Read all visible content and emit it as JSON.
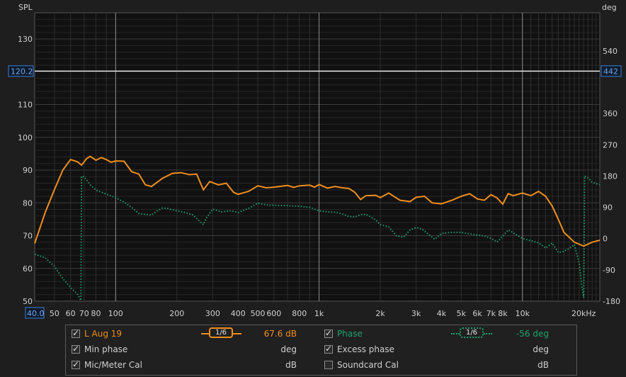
{
  "chart_data": {
    "type": "line",
    "left_axis_label": "SPL",
    "right_axis_label": "deg",
    "x_scale": "log",
    "xlim": [
      40,
      24000
    ],
    "ylim": [
      50,
      138
    ],
    "y2lim": [
      -180,
      650
    ],
    "x_ticks": [
      {
        "v": 50,
        "t": "50"
      },
      {
        "v": 60,
        "t": "60"
      },
      {
        "v": 70,
        "t": "70"
      },
      {
        "v": 80,
        "t": "80"
      },
      {
        "v": 100,
        "t": "100"
      },
      {
        "v": 200,
        "t": "200"
      },
      {
        "v": 300,
        "t": "300"
      },
      {
        "v": 400,
        "t": "400"
      },
      {
        "v": 500,
        "t": "500"
      },
      {
        "v": 600,
        "t": "600"
      },
      {
        "v": 800,
        "t": "800"
      },
      {
        "v": 1000,
        "t": "1k"
      },
      {
        "v": 2000,
        "t": "2k"
      },
      {
        "v": 3000,
        "t": "3k"
      },
      {
        "v": 4000,
        "t": "4k"
      },
      {
        "v": 5000,
        "t": "5k"
      },
      {
        "v": 6000,
        "t": "6k"
      },
      {
        "v": 7000,
        "t": "7k"
      },
      {
        "v": 8000,
        "t": "8k"
      },
      {
        "v": 10000,
        "t": "10k"
      },
      {
        "v": 20000,
        "t": "20kHz"
      }
    ],
    "y_ticks": [
      60,
      70,
      80,
      90,
      100,
      110,
      130
    ],
    "y2_ticks": [
      -180,
      -90,
      0,
      90,
      180,
      270,
      360,
      540
    ],
    "cursor": {
      "x_readout": "40.0",
      "y_readout": "120.2",
      "y2_readout": "442"
    },
    "series": [
      {
        "name": "L Aug 19",
        "axis": "left",
        "color": "#ee8e1c",
        "style": "solid",
        "points": [
          [
            40,
            67.6
          ],
          [
            45,
            77
          ],
          [
            50,
            84
          ],
          [
            55,
            90
          ],
          [
            60,
            93.2
          ],
          [
            65,
            92.5
          ],
          [
            68,
            91.5
          ],
          [
            72,
            93.5
          ],
          [
            75,
            94.2
          ],
          [
            80,
            93
          ],
          [
            85,
            93.8
          ],
          [
            90,
            93.2
          ],
          [
            95,
            92.4
          ],
          [
            100,
            92.8
          ],
          [
            110,
            92.7
          ],
          [
            120,
            89.5
          ],
          [
            130,
            88.8
          ],
          [
            140,
            85.5
          ],
          [
            150,
            85
          ],
          [
            170,
            87.5
          ],
          [
            190,
            89
          ],
          [
            210,
            89.2
          ],
          [
            230,
            88.6
          ],
          [
            250,
            88.8
          ],
          [
            270,
            84
          ],
          [
            290,
            86.5
          ],
          [
            320,
            85.5
          ],
          [
            350,
            86
          ],
          [
            380,
            83.2
          ],
          [
            400,
            82.6
          ],
          [
            450,
            83.5
          ],
          [
            500,
            85.2
          ],
          [
            550,
            84.6
          ],
          [
            600,
            84.8
          ],
          [
            700,
            85.3
          ],
          [
            750,
            84.7
          ],
          [
            800,
            85.2
          ],
          [
            900,
            85.4
          ],
          [
            950,
            84.8
          ],
          [
            1000,
            85.6
          ],
          [
            1100,
            84.5
          ],
          [
            1200,
            85
          ],
          [
            1300,
            84.6
          ],
          [
            1400,
            84.4
          ],
          [
            1500,
            83.2
          ],
          [
            1600,
            81
          ],
          [
            1700,
            82.2
          ],
          [
            1900,
            82.3
          ],
          [
            2000,
            81.6
          ],
          [
            2200,
            83
          ],
          [
            2500,
            80.8
          ],
          [
            2800,
            80.4
          ],
          [
            3000,
            81.7
          ],
          [
            3300,
            82
          ],
          [
            3600,
            80
          ],
          [
            4000,
            79.7
          ],
          [
            4500,
            80.8
          ],
          [
            5000,
            82
          ],
          [
            5500,
            82.8
          ],
          [
            6000,
            81.2
          ],
          [
            6500,
            80.8
          ],
          [
            7000,
            82.5
          ],
          [
            7500,
            81.5
          ],
          [
            8000,
            79.6
          ],
          [
            8500,
            82.8
          ],
          [
            9000,
            82.2
          ],
          [
            10000,
            83
          ],
          [
            11000,
            82.2
          ],
          [
            12000,
            83.5
          ],
          [
            13000,
            82
          ],
          [
            14000,
            79
          ],
          [
            15000,
            75
          ],
          [
            16000,
            71
          ],
          [
            18000,
            68
          ],
          [
            20000,
            66.8
          ],
          [
            22000,
            68
          ],
          [
            24000,
            68.6
          ]
        ]
      },
      {
        "name": "Phase",
        "axis": "right",
        "color": "#20a06e",
        "style": "dotted",
        "points": [
          [
            40,
            -45
          ],
          [
            45,
            -55
          ],
          [
            50,
            -80
          ],
          [
            55,
            -115
          ],
          [
            60,
            -140
          ],
          [
            65,
            -160
          ],
          [
            67.5,
            -178
          ],
          [
            68,
            180
          ],
          [
            70,
            178
          ],
          [
            75,
            155
          ],
          [
            80,
            140
          ],
          [
            90,
            128
          ],
          [
            100,
            118
          ],
          [
            110,
            105
          ],
          [
            120,
            90
          ],
          [
            130,
            72
          ],
          [
            150,
            68
          ],
          [
            160,
            80
          ],
          [
            170,
            88
          ],
          [
            180,
            87
          ],
          [
            200,
            80
          ],
          [
            220,
            75
          ],
          [
            240,
            68
          ],
          [
            270,
            40
          ],
          [
            280,
            60
          ],
          [
            300,
            85
          ],
          [
            330,
            77
          ],
          [
            370,
            80
          ],
          [
            400,
            75
          ],
          [
            450,
            87
          ],
          [
            500,
            102
          ],
          [
            550,
            97
          ],
          [
            600,
            96
          ],
          [
            700,
            95
          ],
          [
            800,
            93
          ],
          [
            900,
            90
          ],
          [
            1000,
            80
          ],
          [
            1100,
            77
          ],
          [
            1200,
            76
          ],
          [
            1300,
            71
          ],
          [
            1400,
            64
          ],
          [
            1500,
            62
          ],
          [
            1600,
            69
          ],
          [
            1700,
            70
          ],
          [
            1800,
            62
          ],
          [
            1900,
            54
          ],
          [
            2000,
            40
          ],
          [
            2200,
            34
          ],
          [
            2400,
            8
          ],
          [
            2600,
            4
          ],
          [
            2800,
            25
          ],
          [
            3000,
            32
          ],
          [
            3200,
            28
          ],
          [
            3500,
            10
          ],
          [
            3700,
            -2
          ],
          [
            4000,
            15
          ],
          [
            4500,
            18
          ],
          [
            5000,
            18
          ],
          [
            5500,
            14
          ],
          [
            6000,
            10
          ],
          [
            6500,
            8
          ],
          [
            7000,
            1
          ],
          [
            7500,
            -10
          ],
          [
            8000,
            7
          ],
          [
            8500,
            25
          ],
          [
            9000,
            17
          ],
          [
            10000,
            0
          ],
          [
            11000,
            -6
          ],
          [
            12000,
            -12
          ],
          [
            13000,
            -27
          ],
          [
            14000,
            -13
          ],
          [
            15000,
            -40
          ],
          [
            16000,
            -37
          ],
          [
            17000,
            -28
          ],
          [
            18000,
            -17
          ],
          [
            19000,
            -70
          ],
          [
            19500,
            -130
          ],
          [
            20000,
            -170
          ],
          [
            20200,
            180
          ],
          [
            21000,
            175
          ],
          [
            22000,
            162
          ],
          [
            24000,
            155
          ]
        ]
      }
    ]
  },
  "legend": {
    "row1": {
      "name": "L Aug 19",
      "smoothing": "1/6",
      "value": "67.6 dB",
      "phase_name": "Phase",
      "phase_smoothing": "1/6",
      "phase_value": "-56 deg"
    },
    "row2": {
      "name": "Min phase",
      "unit": "deg",
      "phase_name": "Excess phase",
      "phase_unit": "deg"
    },
    "row3": {
      "name": "Mic/Meter Cal",
      "unit": "dB",
      "phase_name": "Soundcard Cal",
      "phase_unit": "dB"
    }
  }
}
